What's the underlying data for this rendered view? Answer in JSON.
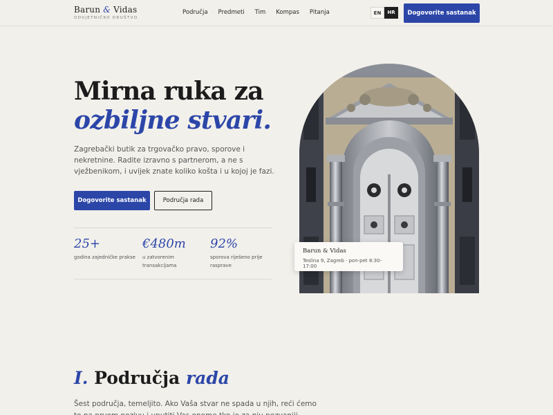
{
  "header": {
    "logo_name_a": "Barun",
    "logo_amp": "&",
    "logo_name_b": "Vidas",
    "logo_sub": "ODVJETNIČKO DRUŠTVO",
    "nav": [
      "Područja",
      "Predmeti",
      "Tim",
      "Kompas",
      "Pitanja"
    ],
    "lang_en": "EN",
    "lang_hr": "HR",
    "lang_active": "HR",
    "cta": "Dogovorite sastanak"
  },
  "hero": {
    "title_line1": "Mirna ruka za",
    "title_line2": "ozbiljne stvari.",
    "text": "Zagrebački butik za trgovačko pravo, sporove i nekretnine. Radite izravno s partnerom, a ne s vježbenikom, i uvijek znate koliko košta i u kojoj je fazi.",
    "primary_button": "Dogovorite sastanak",
    "secondary_button": "Područja rada",
    "stats": [
      {
        "value": "25+",
        "label": "godina zajedničke prakse"
      },
      {
        "value": "€480m",
        "label": "u zatvorenim transakcijama"
      },
      {
        "value": "92%",
        "label": "sporova riješeno prije rasprave"
      }
    ],
    "card_title": "Barun & Vidas",
    "card_sub": "Teslina 9, Zagreb · pon-pet 8:30-17:00"
  },
  "section": {
    "number": "I.",
    "title_a": "Područja",
    "title_b": "rada",
    "text": "Šest područja, temeljito. Ako Vaša stvar ne spada u njih, reći ćemo to na prvom pozivu i uputiti Vas onome tko je za nju pozvaniji."
  },
  "colors": {
    "accent": "#2c46a8",
    "background": "#f2f0eb",
    "dark": "#1f1f1f"
  }
}
